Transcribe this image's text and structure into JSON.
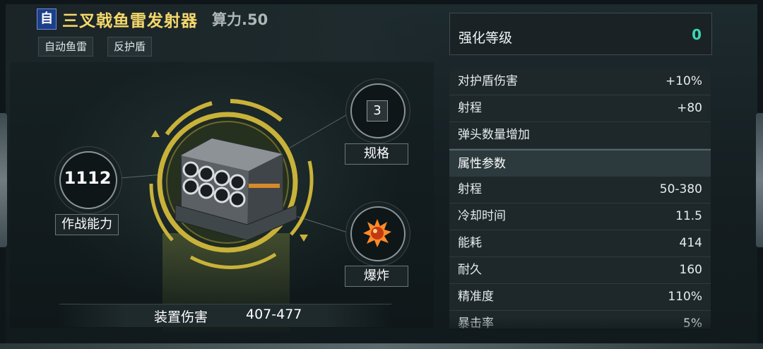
{
  "header": {
    "self_tag": "自",
    "title": "三叉戟鱼雷发射器",
    "power": "算力.50",
    "chips": [
      "自动鱼雷",
      "反护盾"
    ]
  },
  "left": {
    "combat_power_value": "1112",
    "combat_power_label": "作战能力",
    "spec_value": "3",
    "spec_label": "规格",
    "type_label": "爆炸",
    "damage_label": "装置伤害",
    "damage_value": "407-477"
  },
  "right": {
    "enhance_label": "强化等级",
    "enhance_value": "0",
    "bonus_rows": [
      {
        "k": "对护盾伤害",
        "v": "+10%"
      },
      {
        "k": "射程",
        "v": "+80"
      },
      {
        "k": "弹头数量增加",
        "v": ""
      }
    ],
    "section_title": "属性参数",
    "attr_rows": [
      {
        "k": "射程",
        "v": "50-380"
      },
      {
        "k": "冷却时间",
        "v": "11.5"
      },
      {
        "k": "能耗",
        "v": "414"
      },
      {
        "k": "耐久",
        "v": "160"
      },
      {
        "k": "精准度",
        "v": "110%"
      },
      {
        "k": "暴击率",
        "v": "5%"
      }
    ]
  },
  "colors": {
    "title_gold": "#f5d86b",
    "enhance_teal": "#3dd6b4",
    "ring_gold": "#c9b23a"
  }
}
